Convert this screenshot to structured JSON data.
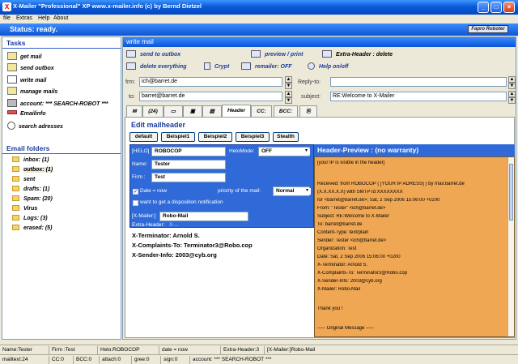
{
  "window": {
    "title": "X-Mailer  \"Professional\" XP       www.x-mailer.info     (c) by Bernd Dietzel"
  },
  "menu": [
    "file",
    "Extras",
    "Help",
    "About"
  ],
  "status": {
    "text": "Status: ready."
  },
  "logo": {
    "text": "Fapro Roboter"
  },
  "sidebar": {
    "tasks_title": "Tasks",
    "tasks": [
      {
        "label": "get mail",
        "icon": "get-mail-icon"
      },
      {
        "label": "send outbox",
        "icon": "send-outbox-icon"
      },
      {
        "label": "write mail",
        "icon": "write-mail-icon"
      },
      {
        "label": "manage mails",
        "icon": "manage-mails-icon"
      },
      {
        "label": "account: *** SEARCH-ROBOT ***",
        "icon": "account-icon"
      },
      {
        "label": "Emailinfo",
        "icon": "emailinfo-icon"
      },
      {
        "label": "search adresses",
        "icon": "search-address-icon"
      }
    ],
    "folders_title": "Email folders",
    "folders": [
      {
        "label": "inbox: (1)"
      },
      {
        "label": "outbox: (1)"
      },
      {
        "label": "sent"
      },
      {
        "label": "drafts: (1)"
      },
      {
        "label": "Spam: (20)"
      },
      {
        "label": "Virus"
      },
      {
        "label": "Logs: (3)"
      },
      {
        "label": "erased: (5)"
      }
    ]
  },
  "main": {
    "title": "write mail",
    "toolbar": {
      "send": "send to outbox",
      "preview": "preview / print",
      "extra_header": "Extra-Header : delete",
      "delete": "delete everything",
      "crypt": "Crypt",
      "remailer": "remailer: OFF",
      "help": "Help on/off"
    },
    "from_label": "frm:",
    "from_value": "ich@barret.de",
    "to_label": "to:",
    "to_value": "barret@barret.de",
    "replyto_label": "Reply-to:",
    "replyto_value": "",
    "subject_label": "subject:",
    "subject_value": "RE:Welcome to X-Mailer",
    "tabs": {
      "attach_count": "(24)",
      "header": "Header",
      "cc": "CC:",
      "bcc": "BCC:"
    },
    "edit_title": "Edit mailheader",
    "presets": [
      "default",
      "Beispiel1",
      "Beispiel2",
      "Beispiel3",
      "Stealth"
    ],
    "form": {
      "helo_label": "[HELO]",
      "helo_value": "ROBOCOP",
      "helomode_label": "HeloMode:",
      "helomode_value": "OFF",
      "name_label": "Name:",
      "name_value": "Tester",
      "firm_label": "Firm :",
      "firm_value": "Test",
      "date_label": "Date = now",
      "priority_label": "priority of the mail:",
      "priority_value": "Normal",
      "disposition_label": "want to get a disposition notification",
      "xmailer_label": "[X-Mailer:]",
      "xmailer_value": "Robo-Mail",
      "extraheader_label": "Extra-Header:",
      "extraheader_value": "X-..."
    },
    "header_lines": [
      "X-Terminator: Arnold S.",
      "X-Complaints-To: Terminator3@Robo.cop",
      "X-Sender-Info: 2003@cyb.org"
    ],
    "preview_title": "Header-Preview : (no warranty)",
    "preview_lines": [
      "[your IP is visible in the header]",
      "",
      "",
      "Received: from ROBOCOP ( [YOUR IP ADRESS] ) by mail.barret.de",
      "(X.X.XX.X.X) with SMTP Id XXXXXXXX",
      "for <barret@barret.de>;  Sat, 2 Sep 2006 15:06:00 +0200",
      "From: \"Tester\" <ich@barret.de>",
      "Subject: RE:Welcome to X-Mailer",
      "To: barret@barret.de",
      "Content-Type: text/plain",
      "Sender: Tester <ich@barret.de>",
      "Organization: Test",
      "Date: Sat, 2 Sep 2006 15:06:00 +0200",
      "X-Terminator: Arnold S.",
      "X-Complaints-To: Terminator3@Robo.cop",
      "X-Sender-Info: 2003@cyb.org",
      "X-Mailer: Robo-Mail",
      "",
      "",
      "Thank you !",
      "",
      "",
      "----- Original Message -----"
    ]
  },
  "statusbar1": [
    "Name:Tester",
    "Firm :Test",
    "Helo:ROBOCOP",
    "date = now",
    "Extra-Header:3",
    "[X-Mailer:]Robo-Mail"
  ],
  "statusbar2": [
    "mailtext:24",
    "CC:0",
    "BCC:0",
    "attach:0",
    "gree:0",
    "sign:0",
    "account: *** SEARCH-ROBOT ***"
  ]
}
